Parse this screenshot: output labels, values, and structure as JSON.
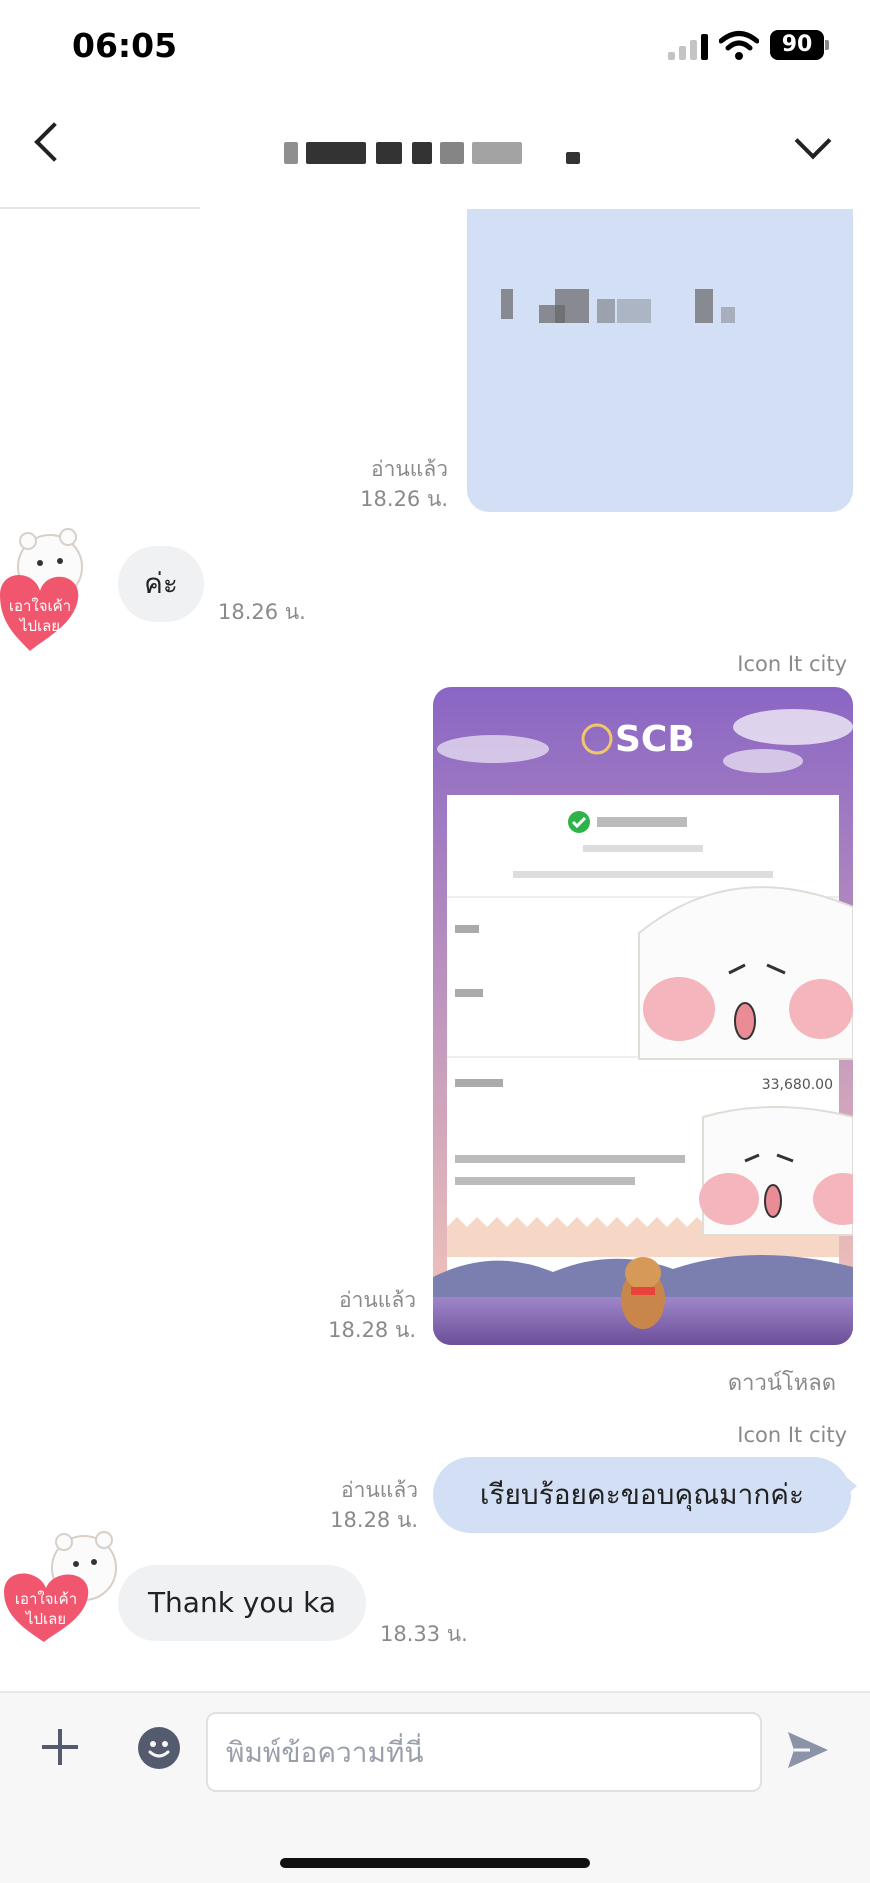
{
  "status_bar": {
    "time": "06:05",
    "battery": "90"
  },
  "header": {
    "title": ""
  },
  "messages": {
    "m1": {
      "status": "อ่านแล้ว",
      "time": "18.26 น."
    },
    "m2": {
      "text": "ค่ะ",
      "time": "18.26 น."
    },
    "m3": {
      "sender": "Icon It city",
      "status": "อ่านแล้ว",
      "time": "18.28 น.",
      "download": "ดาวน์โหลด"
    },
    "m4": {
      "sender": "Icon It city",
      "text": "เรียบร้อยคะขอบคุณมากค่ะ",
      "status": "อ่านแล้ว",
      "time": "18.28 น."
    },
    "m5": {
      "text": "Thank you ka",
      "time": "18.33 น."
    }
  },
  "receipt": {
    "bank": "SCB",
    "amount": "33,680.00"
  },
  "sticker": {
    "text1": "เอาใจเค้า",
    "text2": "ไปเลย"
  },
  "composer": {
    "placeholder": "พิมพ์ข้อความที่นี่"
  },
  "colors": {
    "outgoing_bubble": "#d2dff5",
    "incoming_bubble": "#f0f1f3",
    "sticker_heart": "#f0576f"
  }
}
